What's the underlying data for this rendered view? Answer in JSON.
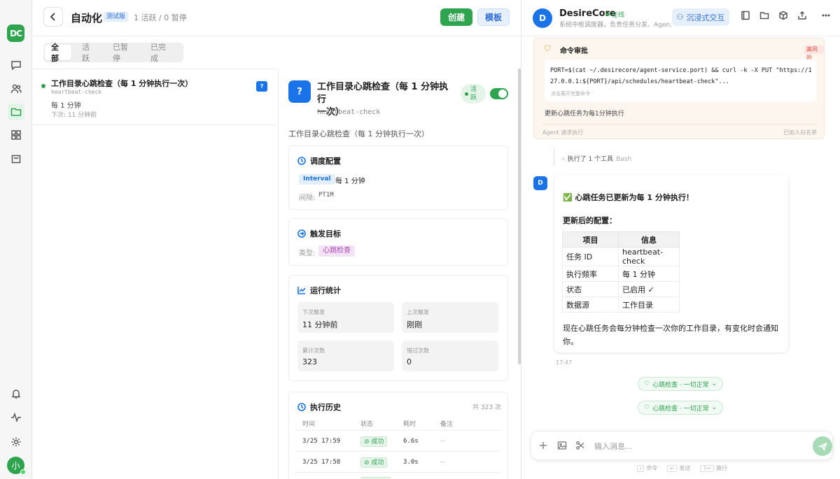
{
  "app": {
    "logo": "DC",
    "user_initial": "小"
  },
  "header": {
    "title": "自动化",
    "beta_badge": "测试版",
    "summary": "1 活跃 / 0 暂停",
    "create_label": "创建",
    "template_label": "模板"
  },
  "tabs": [
    {
      "label": "全部",
      "active": true
    },
    {
      "label": "活跃",
      "active": false
    },
    {
      "label": "已暂停",
      "active": false
    },
    {
      "label": "已完成",
      "active": false
    }
  ],
  "list": [
    {
      "title": "工作目录心跳检查（每 1 分钟执行一次）",
      "id": "heartbeat-check",
      "frequency": "每 1 分钟",
      "next": "下次: 11 分钟前",
      "badge": "?"
    }
  ],
  "detail": {
    "icon": "?",
    "title_line1": "工作目录心跳检查（每 1 分钟执行",
    "title_line2": "一次）",
    "id": "heartbeat-check",
    "status_line1": "活",
    "status_line2": "跃",
    "description": "工作目录心跳检查（每 1 分钟执行一次）",
    "schedule": {
      "heading": "调度配置",
      "type_tag": "Interval",
      "frequency": "每 1 分钟",
      "interval_label": "间隔:",
      "interval_value": "PT1M"
    },
    "trigger": {
      "heading": "触发目标",
      "type_label": "类型:",
      "type_value": "心跳检查"
    },
    "stats": {
      "heading": "运行统计",
      "next_label": "下次触发",
      "next_value": "11 分钟前",
      "last_label": "上次触发",
      "last_value": "刚刚",
      "total_label": "累计次数",
      "total_value": "323",
      "missed_label": "错过次数",
      "missed_value": "0"
    },
    "history": {
      "heading": "执行历史",
      "count": "共 323 次",
      "columns": [
        "时间",
        "状态",
        "耗时",
        "备注"
      ],
      "rows": [
        {
          "time": "3/25 17:59",
          "status": "成功",
          "duration": "6.6s",
          "note": "--"
        },
        {
          "time": "3/25 17:58",
          "status": "成功",
          "duration": "3.0s",
          "note": "--"
        }
      ]
    }
  },
  "chat": {
    "agent_initial": "D",
    "agent_name": "DesireCore",
    "online": "在线",
    "subtitle": "系统中枢调度器，负责任务分发、Agen...",
    "immersive_label": "沉浸式交互",
    "approval": {
      "title": "命令审批",
      "risk": "高风险",
      "command_line1": "PORT=$(cat ~/.desirecore/agent-service.port) && curl -k -X PUT \"https://1",
      "command_line2": "27.0.0.1:${PORT}/api/schedules/heartbeat-check\"...",
      "expand_hint": "点击展开完整命令",
      "description": "更新心跳任务为每1分钟执行",
      "footer_left": "Agent 请求执行",
      "footer_right": "已加入白名单"
    },
    "tool_run": {
      "label": "执行了 1 个工具",
      "tool": "Bash"
    },
    "message": {
      "avatar": "D",
      "headline": "✅ 心跳任务已更新为每 1 分钟执行！",
      "subheading": "更新后的配置：",
      "table_headers": [
        "项目",
        "信息"
      ],
      "table_rows": [
        [
          "任务 ID",
          "heartbeat-check"
        ],
        [
          "执行频率",
          "每 1 分钟"
        ],
        [
          "状态",
          "已启用 ✓"
        ],
        [
          "数据源",
          "工作目录"
        ]
      ],
      "footer": "现在心跳任务会每分钟检查一次你的工作目录，有变化时会通知你。",
      "time": "17:47"
    },
    "pills": [
      "心跳检查 · 一切正常",
      "心跳检查 · 一切正常"
    ],
    "input_placeholder": "输入消息...",
    "hints": [
      {
        "key": "/",
        "label": "命令"
      },
      {
        "key": "↵",
        "label": "发送"
      },
      {
        "key": "⇧↵",
        "label": "换行"
      }
    ]
  },
  "colors": {
    "accent_green": "#2ea44f",
    "accent_blue": "#1a73e8"
  }
}
